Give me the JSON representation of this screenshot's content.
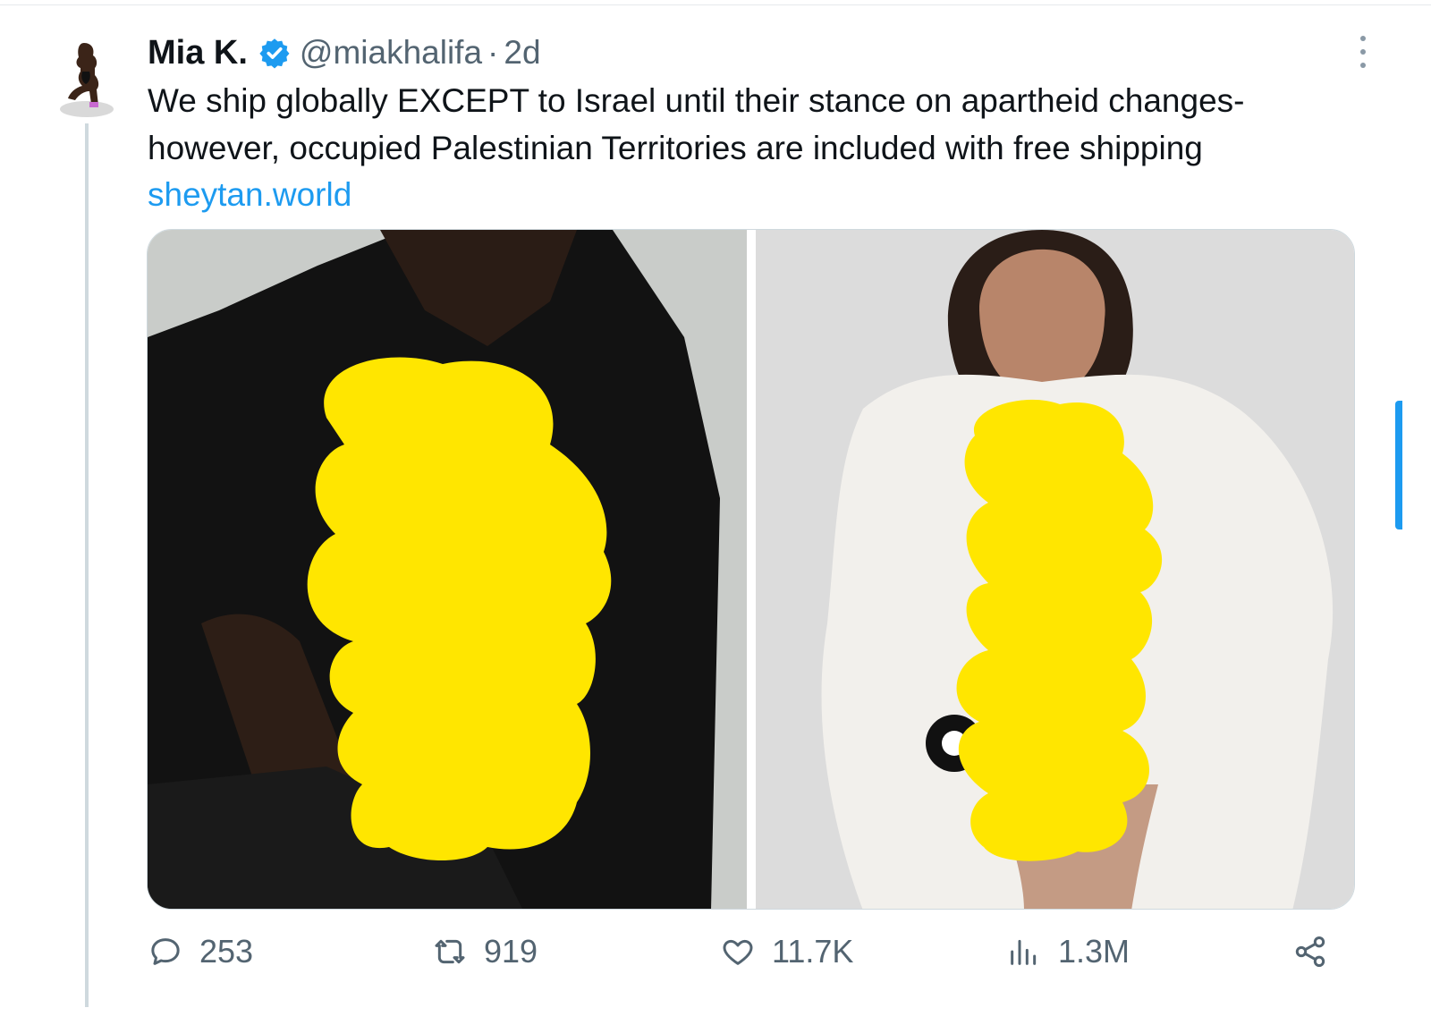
{
  "tweet": {
    "author_name": "Mia K.",
    "handle": "@miakhalifa",
    "separator": "·",
    "time": "2d",
    "text_lines": [
      "We ship globally EXCEPT to Israel until their stance on apartheid changes-",
      "however, occupied Palestinian Territories are included with free shipping"
    ],
    "link": "sheytan.world",
    "icons": {
      "verified": "verified-badge-icon",
      "more": "more-options-icon",
      "reply": "reply-icon",
      "retweet": "retweet-icon",
      "like": "like-icon",
      "views": "views-icon",
      "share": "share-icon"
    },
    "metrics": {
      "replies": "253",
      "retweets": "919",
      "likes": "11.7K",
      "views": "1.3M"
    }
  },
  "colors": {
    "link": "#1d9bf0",
    "secondary_text": "#536471",
    "censor_overlay": "#ffe600",
    "thread_line": "#cfd9de"
  }
}
